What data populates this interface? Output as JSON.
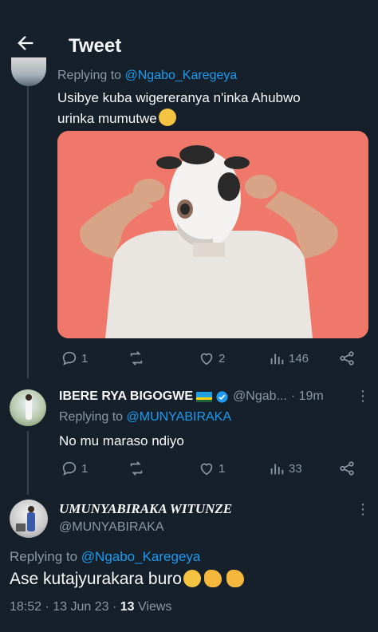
{
  "header": {
    "title": "Tweet"
  },
  "tweet1": {
    "replying_prefix": "Replying to ",
    "replying_handle": "@Ngabo_Karegeya",
    "text_line1": "Usibye kuba wigereranya n'inka Ahubwo",
    "text_line2": "urinka mumutwe",
    "replies": "1",
    "retweets": "",
    "likes": "2",
    "views": "146"
  },
  "tweet2": {
    "name": "IBERE RYA BIGOGWE",
    "handle": "@Ngab...",
    "time": "· 19m",
    "replying_prefix": "Replying to ",
    "replying_handle": "@MUNYABIRAKA",
    "text": "No mu maraso ndiyo",
    "replies": "1",
    "likes": "1",
    "views": "33"
  },
  "main_tweet": {
    "name": "UMUNYABIRAKA WITUNZE",
    "handle": "@MUNYABIRAKA",
    "replying_prefix": "Replying to ",
    "replying_handle": "@Ngabo_Karegeya",
    "text": "Ase kutajyurakara buro",
    "time": "18:52 · 13 Jun 23 · ",
    "views_count": "13",
    "views_label": " Views"
  },
  "icons": [
    "back-arrow-icon",
    "reply-icon",
    "retweet-icon",
    "like-icon",
    "views-icon",
    "share-icon",
    "verified-icon",
    "rwanda-flag-icon",
    "more-icon"
  ],
  "colors": {
    "background": "#15202b",
    "accent": "#1d9bf0",
    "muted": "#8b98a5",
    "media_bg": "#f0786a"
  }
}
